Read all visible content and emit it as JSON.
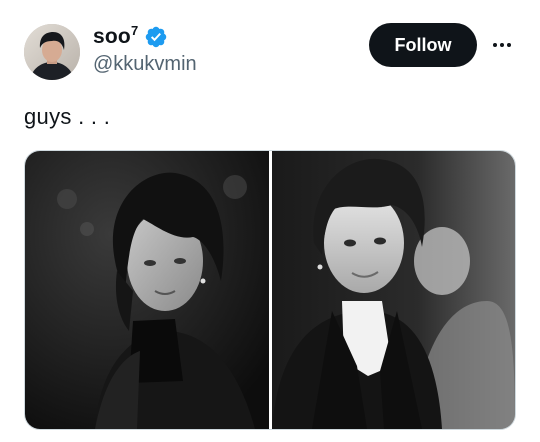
{
  "tweet": {
    "author": {
      "display_name": "soo",
      "display_name_superscript": "7",
      "handle": "@kkukvmin",
      "verified": true,
      "avatar_icon": "profile-photo"
    },
    "follow_label": "Follow",
    "more_icon": "more-horizontal-icon",
    "text": "guys . . .",
    "media": {
      "count": 2,
      "photos": [
        {
          "icon": "grayscale-portrait-photo"
        },
        {
          "icon": "grayscale-portrait-photo"
        }
      ]
    }
  },
  "colors": {
    "text_primary": "#0f1419",
    "text_secondary": "#536471",
    "verified_blue": "#1d9bf0",
    "follow_bg": "#0f1419",
    "border": "#cfd9de"
  }
}
